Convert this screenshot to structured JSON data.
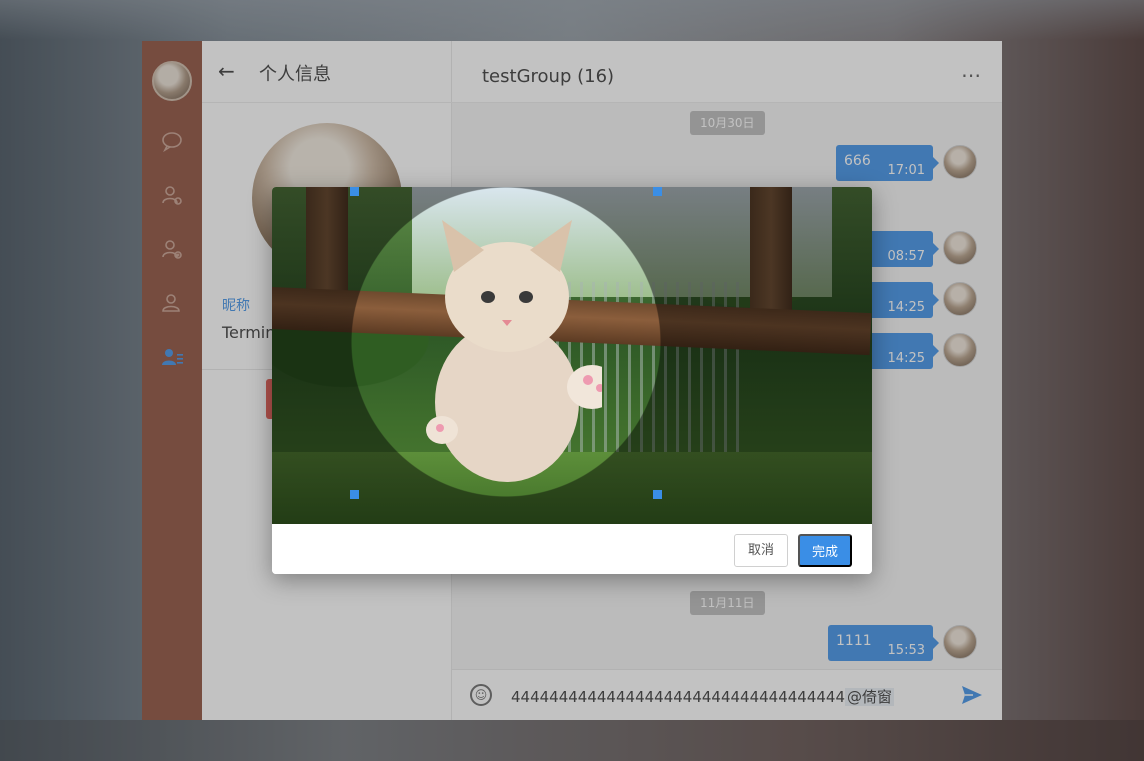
{
  "panel": {
    "back_icon": "arrow-left-icon",
    "title": "个人信息",
    "nickname_label": "昵称",
    "nickname_value": "Termin"
  },
  "rail": {
    "icons": [
      "chat-bubble-icon",
      "group-settings-icon",
      "add-contact-icon",
      "contact-icon",
      "profile-list-icon"
    ],
    "active_index": 4
  },
  "chat": {
    "title": "testGroup (16)",
    "more_icon": "more-dots-icon",
    "dates": [
      "10月30日",
      "11月11日"
    ],
    "messages": [
      {
        "text": "666",
        "time": "17:01"
      },
      {
        "text": "",
        "time": "08:57"
      },
      {
        "text": "",
        "time": "14:25"
      },
      {
        "text": "",
        "time": "14:25"
      },
      {
        "text": "1111",
        "time": "15:53"
      }
    ],
    "composer": {
      "text": "44444444444444444444444444444444444",
      "mention": "@倚窗",
      "emoji_icon": "emoji-icon",
      "send_icon": "send-icon"
    }
  },
  "dialog": {
    "cancel_label": "取消",
    "done_label": "完成"
  },
  "colors": {
    "accent": "#3a8ee6",
    "rail": "#8a4a37",
    "danger": "#e5534b"
  }
}
